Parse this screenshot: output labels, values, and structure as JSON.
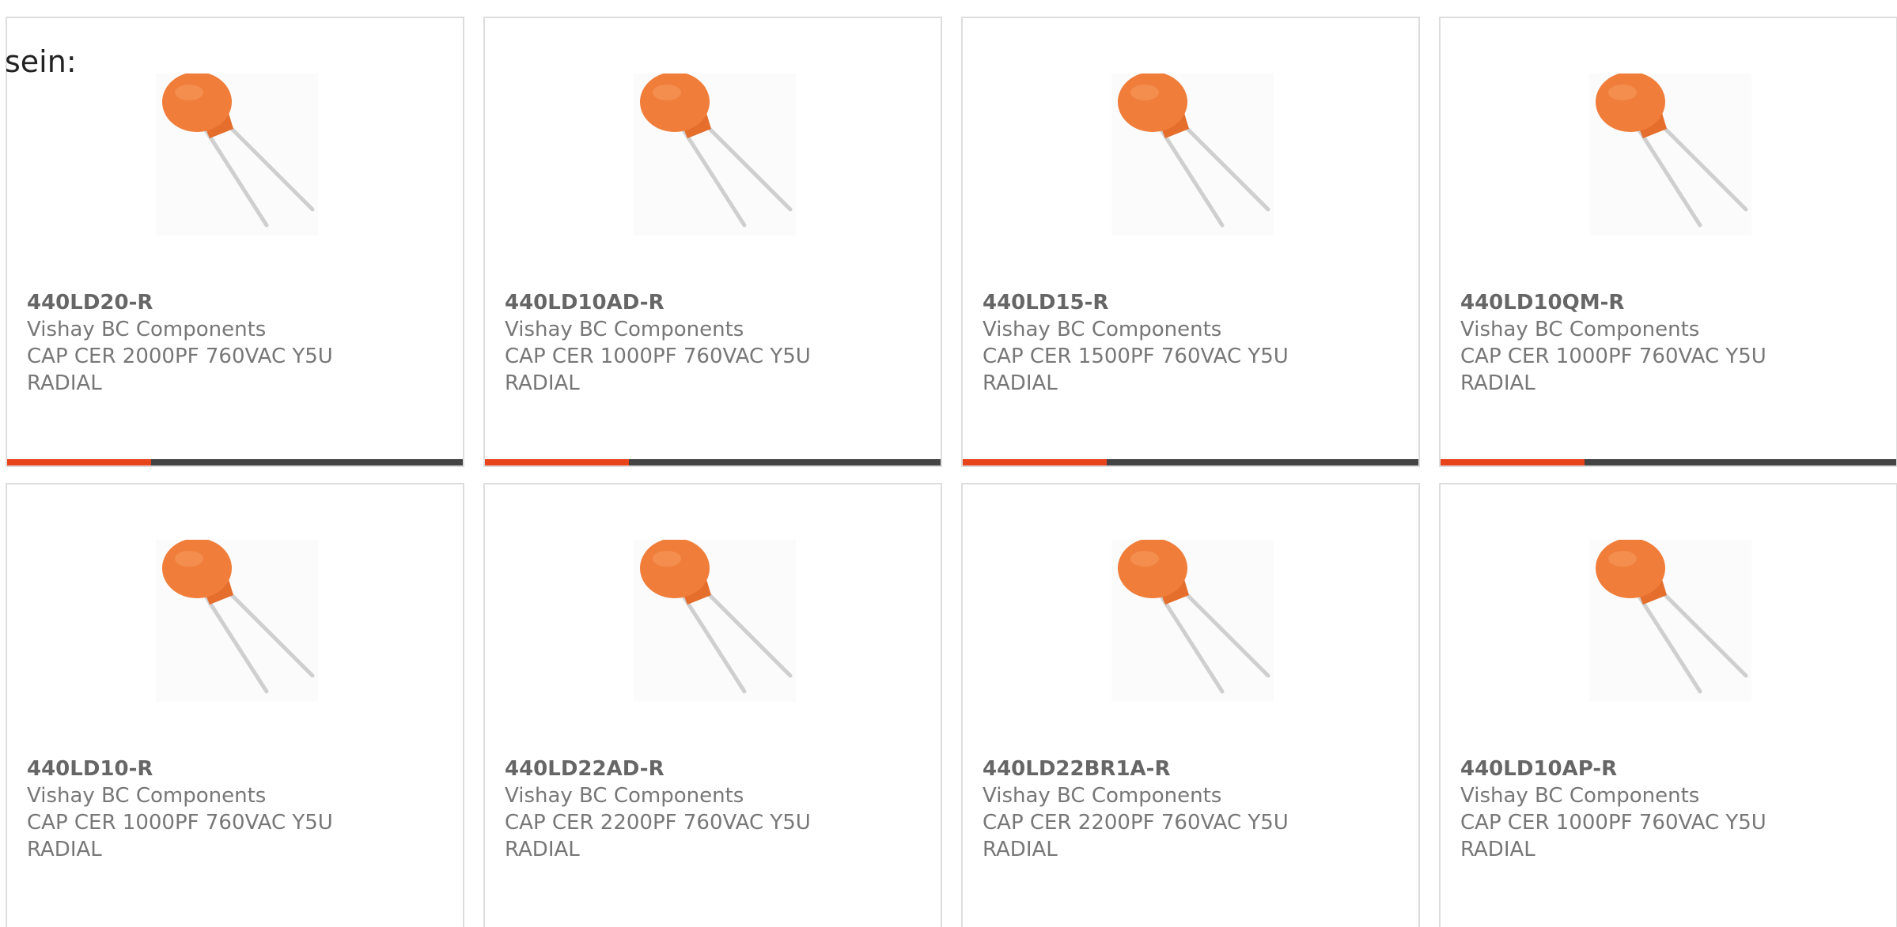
{
  "lead_text": "sein:",
  "colors": {
    "accent": "#e8441c",
    "bar": "#444444",
    "capacitor": "#f07d3a",
    "text": "#777777"
  },
  "products": [
    {
      "part_number": "440LD20-R",
      "manufacturer": "Vishay BC Components",
      "description_line1": "CAP CER 2000PF 760VAC Y5U",
      "description_line2": "RADIAL",
      "image_icon": "ceramic-disc-capacitor-icon"
    },
    {
      "part_number": "440LD10AD-R",
      "manufacturer": "Vishay BC Components",
      "description_line1": "CAP CER 1000PF 760VAC Y5U",
      "description_line2": "RADIAL",
      "image_icon": "ceramic-disc-capacitor-icon"
    },
    {
      "part_number": "440LD15-R",
      "manufacturer": "Vishay BC Components",
      "description_line1": "CAP CER 1500PF 760VAC Y5U",
      "description_line2": "RADIAL",
      "image_icon": "ceramic-disc-capacitor-icon"
    },
    {
      "part_number": "440LD10QM-R",
      "manufacturer": "Vishay BC Components",
      "description_line1": "CAP CER 1000PF 760VAC Y5U",
      "description_line2": "RADIAL",
      "image_icon": "ceramic-disc-capacitor-icon"
    },
    {
      "part_number": "440LD10-R",
      "manufacturer": "Vishay BC Components",
      "description_line1": "CAP CER 1000PF 760VAC Y5U",
      "description_line2": "RADIAL",
      "image_icon": "ceramic-disc-capacitor-icon"
    },
    {
      "part_number": "440LD22AD-R",
      "manufacturer": "Vishay BC Components",
      "description_line1": "CAP CER 2200PF 760VAC Y5U",
      "description_line2": "RADIAL",
      "image_icon": "ceramic-disc-capacitor-icon"
    },
    {
      "part_number": "440LD22BR1A-R",
      "manufacturer": "Vishay BC Components",
      "description_line1": "CAP CER 2200PF 760VAC Y5U",
      "description_line2": "RADIAL",
      "image_icon": "ceramic-disc-capacitor-icon"
    },
    {
      "part_number": "440LD10AP-R",
      "manufacturer": "Vishay BC Components",
      "description_line1": "CAP CER 1000PF 760VAC Y5U",
      "description_line2": "RADIAL",
      "image_icon": "ceramic-disc-capacitor-icon"
    }
  ]
}
